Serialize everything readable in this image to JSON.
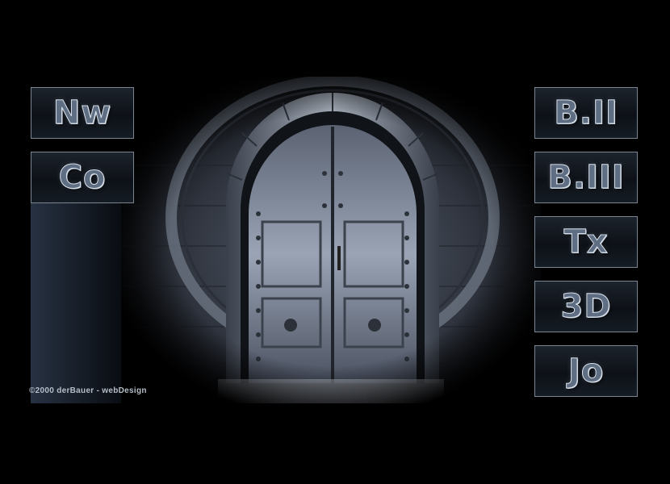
{
  "nav_left": [
    {
      "label": "Nw"
    },
    {
      "label": "Co"
    }
  ],
  "nav_right": [
    {
      "label": "B.II"
    },
    {
      "label": "B.III"
    },
    {
      "label": "Tx"
    },
    {
      "label": "3D"
    },
    {
      "label": "Jo"
    }
  ],
  "footer": {
    "copyright": "©2000 derBauer - webDesign"
  },
  "colors": {
    "background": "#000000",
    "button_border": "#7a8594",
    "stone": "#6e7684",
    "door_metal": "#8a93a3"
  },
  "icons": {
    "door_image": "arched-stone-doorway"
  }
}
